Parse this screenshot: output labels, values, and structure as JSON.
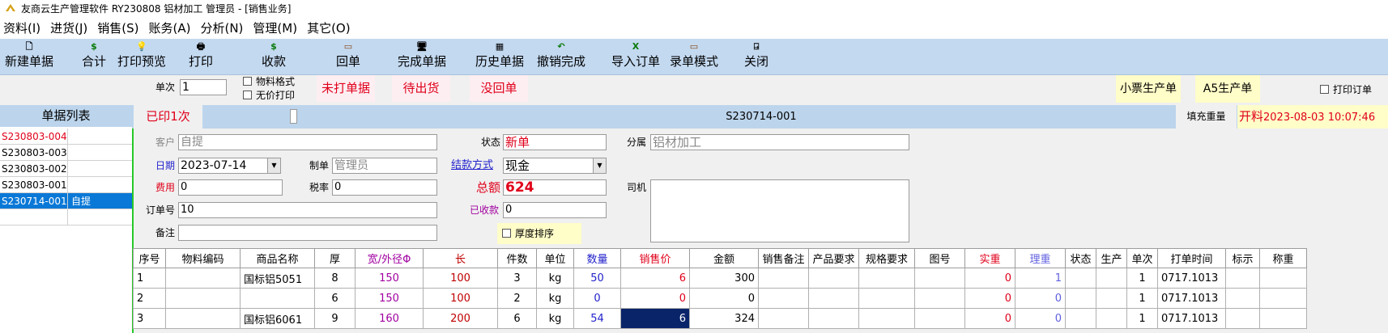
{
  "title": {
    "text": "友商云生产管理软件 RY230808    铝材加工    管理员 - [销售业务]"
  },
  "menu": [
    "资料(I)",
    "进货(J)",
    "销售(S)",
    "账务(A)",
    "分析(N)",
    "管理(M)",
    "其它(O)"
  ],
  "toolbar": [
    {
      "label": "新建单据",
      "icon": "new-document-icon",
      "glyph": "🗋"
    },
    {
      "label": "合计",
      "icon": "dollar-icon",
      "glyph": "$"
    },
    {
      "label": "打印预览",
      "icon": "lightbulb-icon",
      "glyph": "💡"
    },
    {
      "label": "打印",
      "icon": "printer-icon",
      "glyph": "🖶"
    },
    {
      "label": "收款",
      "icon": "dollar-icon",
      "glyph": "$"
    },
    {
      "label": "回单",
      "icon": "receipt-icon",
      "glyph": "▭"
    },
    {
      "label": "完成单据",
      "icon": "finish-icon",
      "glyph": "🖥"
    },
    {
      "label": "历史单据",
      "icon": "history-icon",
      "glyph": "▦"
    },
    {
      "label": "撤销完成",
      "icon": "undo-icon",
      "glyph": "↶"
    },
    {
      "label": "导入订单",
      "icon": "excel-icon",
      "glyph": "X"
    },
    {
      "label": "录单模式",
      "icon": "entry-mode-icon",
      "glyph": "▭"
    },
    {
      "label": "关闭",
      "icon": "exit-door-icon",
      "glyph": "⍈"
    }
  ],
  "options": {
    "batch_label": "单次",
    "batch_value": "1",
    "material_format": "物料格式",
    "no_price_print": "无价打印",
    "btn_unprinted": "未打单据",
    "btn_pending": "待出货",
    "btn_no_receipt": "没回单",
    "btn_ticket": "小票生产单",
    "btn_a5": "A5生产单",
    "print_order": "打印订单"
  },
  "list": {
    "header": "单据列表",
    "rows": [
      {
        "id": "S230803-004",
        "name": "",
        "red": true
      },
      {
        "id": "S230803-003",
        "name": ""
      },
      {
        "id": "S230803-002",
        "name": ""
      },
      {
        "id": "S230803-001",
        "name": ""
      },
      {
        "id": "S230714-001",
        "name": "自提",
        "selected": true
      }
    ]
  },
  "header": {
    "printed": "已印1次",
    "order_no": "S230714-001",
    "fill_weight": "填充重量",
    "open_label": "开料",
    "open_time": "2023-08-03 10:07:46"
  },
  "form": {
    "customer_label": "客户",
    "customer": "自提",
    "status_label": "状态",
    "status": "新单",
    "branch_label": "分属",
    "branch": "铝材加工",
    "date_label": "日期",
    "date": "2023-07-14",
    "maker_label": "制单",
    "maker": "管理员",
    "settle_label": "结款方式",
    "settle": "现金",
    "fee_label": "费用",
    "fee": "0",
    "tax_label": "税率",
    "tax": "0",
    "total_label": "总额",
    "total": "624",
    "driver_label": "司机",
    "driver": "",
    "orderno_label": "订单号",
    "orderno": "10",
    "received_label": "已收款",
    "received": "0",
    "note_label": "备注",
    "note": "",
    "thick_sort": "厚度排序"
  },
  "colors": {
    "accent": "#2222cc",
    "price_red": "#e0001a",
    "purple": "#a000a0",
    "selected": "#0a246a",
    "toolbar": "#c3d9f0"
  },
  "grid": {
    "columns": [
      "序号",
      "物料编码",
      "商品名称",
      "厚",
      "宽/外径Φ",
      "长",
      "件数",
      "单位",
      "数量",
      "销售价",
      "金额",
      "销售备注",
      "产品要求",
      "规格要求",
      "图号",
      "实重",
      "理重",
      "状态",
      "生产",
      "单次",
      "打单时间",
      "标示",
      "称重"
    ],
    "rows": [
      [
        "1",
        "",
        "国标铝5051",
        "8",
        "150",
        "100",
        "3",
        "kg",
        "50",
        "6",
        "300",
        "",
        "",
        "",
        "",
        "0",
        "1",
        "",
        "",
        "1",
        "0717.1013",
        "",
        ""
      ],
      [
        "2",
        "",
        "",
        "6",
        "150",
        "100",
        "2",
        "kg",
        "0",
        "0",
        "0",
        "",
        "",
        "",
        "",
        "0",
        "0",
        "",
        "",
        "1",
        "0717.1013",
        "",
        ""
      ],
      [
        "3",
        "",
        "国标铝6061",
        "9",
        "160",
        "200",
        "6",
        "kg",
        "54",
        "6",
        "324",
        "",
        "",
        "",
        "",
        "0",
        "0",
        "",
        "",
        "1",
        "0717.1013",
        "",
        ""
      ]
    ]
  }
}
